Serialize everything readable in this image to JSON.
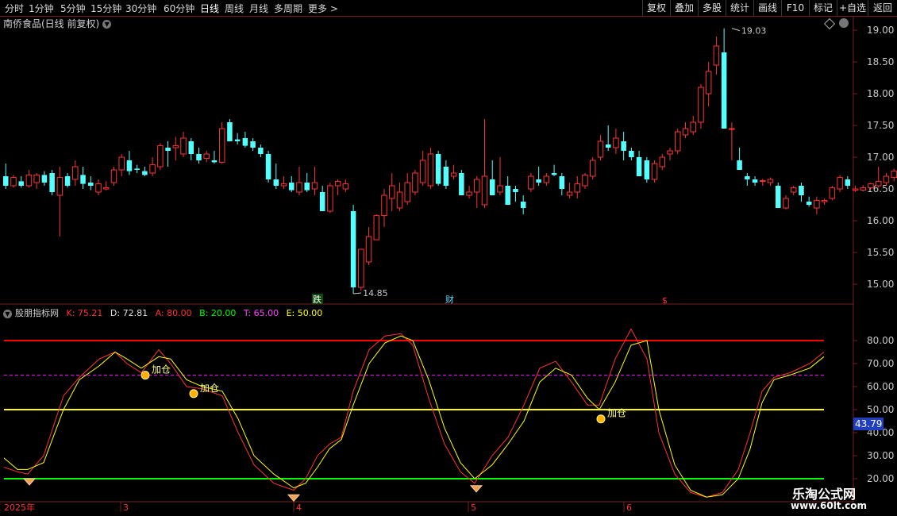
{
  "toolbar": {
    "periods": [
      "分时",
      "1分钟",
      "5分钟",
      "15分钟",
      "30分钟",
      "60分钟",
      "日线",
      "周线",
      "月线",
      "多周期",
      "更多"
    ],
    "more_arrow": ">",
    "active_period": "日线",
    "buttons": [
      "复权",
      "叠加",
      "多股",
      "统计",
      "画线",
      "F10",
      "标记",
      "+自选",
      "返回"
    ]
  },
  "chart_title": "南侨食品(日线 前复权)",
  "price_axis": [
    "19.00",
    "18.50",
    "18.00",
    "17.50",
    "17.00",
    "16.50",
    "16.00",
    "15.50",
    "15.00"
  ],
  "annotations": {
    "high": "19.03",
    "low": "14.85",
    "events": [
      "跌",
      "财",
      "$"
    ]
  },
  "indicator": {
    "name": "股朋指标网",
    "K": "K: 75.21",
    "D": "D: 72.81",
    "A": "A: 80.00",
    "B": "B: 20.00",
    "T": "T: 65.00",
    "E": "E: 50.00",
    "axis": [
      "80.00",
      "70.00",
      "60.00",
      "50.00",
      "40.00",
      "30.00",
      "20.00"
    ],
    "current_value": "43.79",
    "signal_label": "加仓"
  },
  "date_axis": [
    "2025年",
    "3",
    "4",
    "5",
    "6"
  ],
  "watermark": {
    "line1": "乐淘公式网",
    "line2": "www.60lt.com"
  },
  "colors": {
    "up": "#ff3232",
    "down": "#54ffff",
    "K": "#ff3232",
    "D": "#ffff00",
    "A": "#ff0000",
    "B": "#00ff00",
    "T": "#ff00ff",
    "E": "#ffff00"
  },
  "chart_data": {
    "type": "candlestick",
    "ylim_price": [
      14.7,
      19.2
    ],
    "candles": [
      [
        16.7,
        16.9,
        16.5,
        16.55
      ],
      [
        16.55,
        16.72,
        16.52,
        16.68
      ],
      [
        16.62,
        16.7,
        16.52,
        16.55
      ],
      [
        16.55,
        16.8,
        16.52,
        16.72
      ],
      [
        16.6,
        16.75,
        16.5,
        16.72
      ],
      [
        16.72,
        16.78,
        16.55,
        16.6
      ],
      [
        16.75,
        16.8,
        16.4,
        16.45
      ],
      [
        16.4,
        16.85,
        15.75,
        16.68
      ],
      [
        16.7,
        16.75,
        16.52,
        16.55
      ],
      [
        16.65,
        16.95,
        16.55,
        16.85
      ],
      [
        16.72,
        16.85,
        16.5,
        16.58
      ],
      [
        16.6,
        16.7,
        16.48,
        16.55
      ],
      [
        16.45,
        16.65,
        16.4,
        16.58
      ],
      [
        16.5,
        16.62,
        16.48,
        16.52
      ],
      [
        16.6,
        16.85,
        16.55,
        16.8
      ],
      [
        16.8,
        17.05,
        16.7,
        17.0
      ],
      [
        16.95,
        17.1,
        16.72,
        16.78
      ],
      [
        16.82,
        16.88,
        16.75,
        16.8
      ],
      [
        16.78,
        16.85,
        16.7,
        16.72
      ],
      [
        16.75,
        17.0,
        16.7,
        16.88
      ],
      [
        16.85,
        17.22,
        16.8,
        17.18
      ],
      [
        17.15,
        17.25,
        16.85,
        17.1
      ],
      [
        17.15,
        17.32,
        16.95,
        17.18
      ],
      [
        17.05,
        17.4,
        17.0,
        17.3
      ],
      [
        17.25,
        17.3,
        16.95,
        17.05
      ],
      [
        17.05,
        17.15,
        16.9,
        16.95
      ],
      [
        16.98,
        17.1,
        16.92,
        17.05
      ],
      [
        16.95,
        17.1,
        16.9,
        16.92
      ],
      [
        16.92,
        17.55,
        16.9,
        17.45
      ],
      [
        17.55,
        17.6,
        17.25,
        17.25
      ],
      [
        17.28,
        17.38,
        17.2,
        17.25
      ],
      [
        17.3,
        17.4,
        17.15,
        17.18
      ],
      [
        17.25,
        17.3,
        17.1,
        17.15
      ],
      [
        17.15,
        17.2,
        17.0,
        17.05
      ],
      [
        17.05,
        17.1,
        16.6,
        16.65
      ],
      [
        16.65,
        16.9,
        16.5,
        16.55
      ],
      [
        16.55,
        16.7,
        16.5,
        16.58
      ],
      [
        16.6,
        16.7,
        16.45,
        16.48
      ],
      [
        16.45,
        16.85,
        16.4,
        16.6
      ],
      [
        16.6,
        16.75,
        16.45,
        16.48
      ],
      [
        16.5,
        16.85,
        16.4,
        16.6
      ],
      [
        16.45,
        16.55,
        16.15,
        16.15
      ],
      [
        16.15,
        16.6,
        16.12,
        16.55
      ],
      [
        16.55,
        16.65,
        16.4,
        16.62
      ],
      [
        16.5,
        16.65,
        16.45,
        16.58
      ],
      [
        16.15,
        16.25,
        14.85,
        14.95
      ],
      [
        14.95,
        15.55,
        14.9,
        15.55
      ],
      [
        15.35,
        15.9,
        15.3,
        15.75
      ],
      [
        15.7,
        16.1,
        15.7,
        16.08
      ],
      [
        16.08,
        16.5,
        15.9,
        16.4
      ],
      [
        16.35,
        16.75,
        16.15,
        16.55
      ],
      [
        16.2,
        16.6,
        16.15,
        16.45
      ],
      [
        16.3,
        16.75,
        16.25,
        16.6
      ],
      [
        16.45,
        16.8,
        16.4,
        16.75
      ],
      [
        16.6,
        17.1,
        16.55,
        16.95
      ],
      [
        16.55,
        17.15,
        16.5,
        17.05
      ],
      [
        17.05,
        17.1,
        16.55,
        16.58
      ],
      [
        16.85,
        16.95,
        16.5,
        16.55
      ],
      [
        16.7,
        16.88,
        16.65,
        16.75
      ],
      [
        16.75,
        16.8,
        16.4,
        16.4
      ],
      [
        16.4,
        16.55,
        16.35,
        16.45
      ],
      [
        16.45,
        16.7,
        16.2,
        16.65
      ],
      [
        16.25,
        17.6,
        16.2,
        16.7
      ],
      [
        16.65,
        16.95,
        16.55,
        16.4
      ],
      [
        16.45,
        17.0,
        16.4,
        16.55
      ],
      [
        16.55,
        16.7,
        16.3,
        16.25
      ],
      [
        16.5,
        16.55,
        16.3,
        16.45
      ],
      [
        16.3,
        16.4,
        16.1,
        16.2
      ],
      [
        16.5,
        16.75,
        16.45,
        16.7
      ],
      [
        16.65,
        16.85,
        16.55,
        16.6
      ],
      [
        16.6,
        16.75,
        16.55,
        16.7
      ],
      [
        16.75,
        16.88,
        16.7,
        16.72
      ],
      [
        16.7,
        16.75,
        16.4,
        16.5
      ],
      [
        16.4,
        16.6,
        16.35,
        16.45
      ],
      [
        16.45,
        16.7,
        16.35,
        16.58
      ],
      [
        16.55,
        16.75,
        16.5,
        16.72
      ],
      [
        16.7,
        17.0,
        16.65,
        16.95
      ],
      [
        17.0,
        17.35,
        16.95,
        17.25
      ],
      [
        17.2,
        17.5,
        17.1,
        17.15
      ],
      [
        17.15,
        17.45,
        17.05,
        17.3
      ],
      [
        17.25,
        17.4,
        16.95,
        17.1
      ],
      [
        17.1,
        17.15,
        16.95,
        17.0
      ],
      [
        17.0,
        17.1,
        16.7,
        16.7
      ],
      [
        16.95,
        17.0,
        16.6,
        16.65
      ],
      [
        16.65,
        16.95,
        16.6,
        16.9
      ],
      [
        16.85,
        17.05,
        16.8,
        17.0
      ],
      [
        17.05,
        17.15,
        16.95,
        17.1
      ],
      [
        17.1,
        17.45,
        17.05,
        17.4
      ],
      [
        17.35,
        17.55,
        17.3,
        17.45
      ],
      [
        17.4,
        17.65,
        17.35,
        17.55
      ],
      [
        17.55,
        18.15,
        17.45,
        18.1
      ],
      [
        18.0,
        18.5,
        17.8,
        18.35
      ],
      [
        18.45,
        18.9,
        18.3,
        18.75
      ],
      [
        18.65,
        19.03,
        17.45,
        17.45
      ],
      [
        17.45,
        17.55,
        16.95,
        17.45
      ],
      [
        16.95,
        17.15,
        16.8,
        16.8
      ],
      [
        16.7,
        16.75,
        16.55,
        16.65
      ],
      [
        16.65,
        16.7,
        16.55,
        16.6
      ],
      [
        16.62,
        16.66,
        16.55,
        16.63
      ],
      [
        16.6,
        16.68,
        16.55,
        16.65
      ],
      [
        16.55,
        16.6,
        16.4,
        16.2
      ],
      [
        16.2,
        16.4,
        16.18,
        16.35
      ],
      [
        16.45,
        16.55,
        16.4,
        16.52
      ],
      [
        16.55,
        16.6,
        16.3,
        16.4
      ],
      [
        16.3,
        16.38,
        16.22,
        16.25
      ],
      [
        16.2,
        16.38,
        16.1,
        16.32
      ],
      [
        16.3,
        16.35,
        16.25,
        16.32
      ],
      [
        16.35,
        16.55,
        16.32,
        16.52
      ],
      [
        16.5,
        16.72,
        16.45,
        16.68
      ],
      [
        16.65,
        16.7,
        16.5,
        16.55
      ],
      [
        16.48,
        16.55,
        16.45,
        16.5
      ],
      [
        16.48,
        16.56,
        16.46,
        16.52
      ],
      [
        16.52,
        16.6,
        16.5,
        16.58
      ],
      [
        16.55,
        16.85,
        16.52,
        16.62
      ],
      [
        16.6,
        16.75,
        16.55,
        16.7
      ],
      [
        16.68,
        16.82,
        16.62,
        16.78
      ],
      [
        16.85,
        17.08,
        16.8,
        16.95
      ]
    ]
  }
}
